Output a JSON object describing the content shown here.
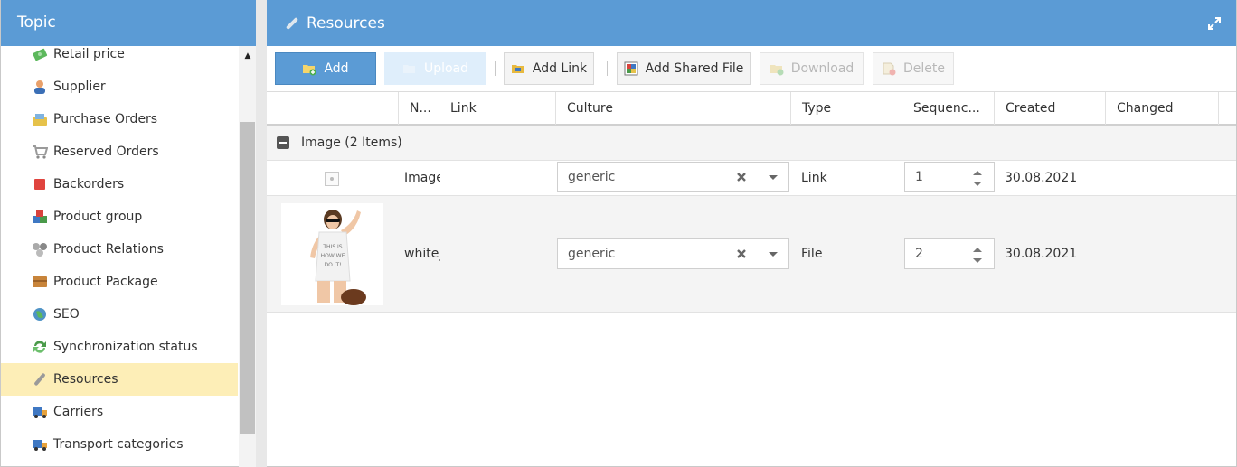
{
  "topic": {
    "title": "Topic",
    "items": [
      {
        "label": "Retail price",
        "icon": "money-icon"
      },
      {
        "label": "Supplier",
        "icon": "person-icon"
      },
      {
        "label": "Purchase Orders",
        "icon": "purchase-orders-icon"
      },
      {
        "label": "Reserved Orders",
        "icon": "cart-icon"
      },
      {
        "label": "Backorders",
        "icon": "red-square-icon"
      },
      {
        "label": "Product group",
        "icon": "cubes-icon"
      },
      {
        "label": "Product Relations",
        "icon": "relations-icon"
      },
      {
        "label": "Product Package",
        "icon": "package-icon"
      },
      {
        "label": "SEO",
        "icon": "globe-icon"
      },
      {
        "label": "Synchronization status",
        "icon": "sync-icon"
      },
      {
        "label": "Resources",
        "icon": "paperclip-icon",
        "active": true
      },
      {
        "label": "Carriers",
        "icon": "truck-icon"
      },
      {
        "label": "Transport categories",
        "icon": "truck-icon"
      }
    ]
  },
  "resources": {
    "title": "Resources",
    "toolbar": {
      "add": "Add",
      "upload": "Upload",
      "add_link": "Add Link",
      "add_shared_file": "Add Shared File",
      "download": "Download",
      "delete": "Delete"
    },
    "columns": [
      "N...",
      "Link",
      "Culture",
      "Type",
      "Sequenc...",
      "Created",
      "Changed"
    ],
    "group": {
      "label": "Image (2 Items)"
    },
    "rows": [
      {
        "name": "Image",
        "culture": "generic",
        "type": "Link",
        "sequence": "1",
        "created": "30.08.2021",
        "changed": ""
      },
      {
        "name": "white_",
        "culture": "generic",
        "type": "File",
        "sequence": "2",
        "created": "30.08.2021",
        "changed": "",
        "thumb_text": "THIS IS HOW WE DO IT!"
      }
    ]
  },
  "colors": {
    "header_blue": "#5b9bd5",
    "active_item": "#fdeeb7",
    "group_row": "#f4f4f4"
  }
}
